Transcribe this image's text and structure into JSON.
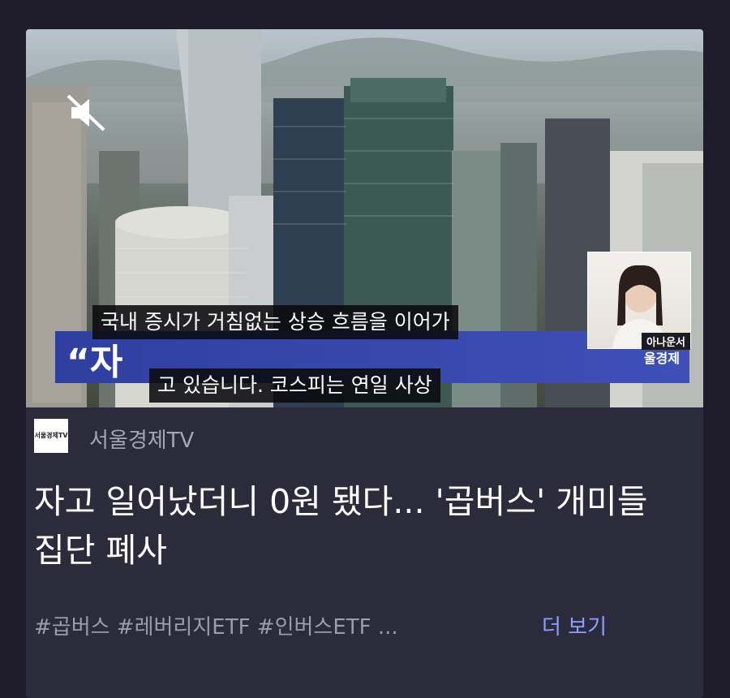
{
  "video": {
    "pip_label": "아나운서",
    "lower_third_quote": "“자",
    "lower_third_brand": "울경제",
    "caption_line1": "국내 증시가 거침없는 상승 흐름을 이어가",
    "caption_line2": "고 있습니다. 코스피는 연일 사상",
    "mute_icon": "speaker-muted-icon"
  },
  "channel": {
    "logo_text": "서울경제TV",
    "name": "서울경제TV"
  },
  "article": {
    "title": "자고 일어났더니 0원 됐다... '곱버스' 개미들 집단 폐사",
    "tags": "#곱버스 #레버리지ETF #인버스ETF ...",
    "more_label": "더 보기"
  },
  "colors": {
    "background": "#1f1d2b",
    "card": "#2c2b3c",
    "accent_link": "#8ea0ff",
    "muted_text": "#a6a5b3"
  }
}
